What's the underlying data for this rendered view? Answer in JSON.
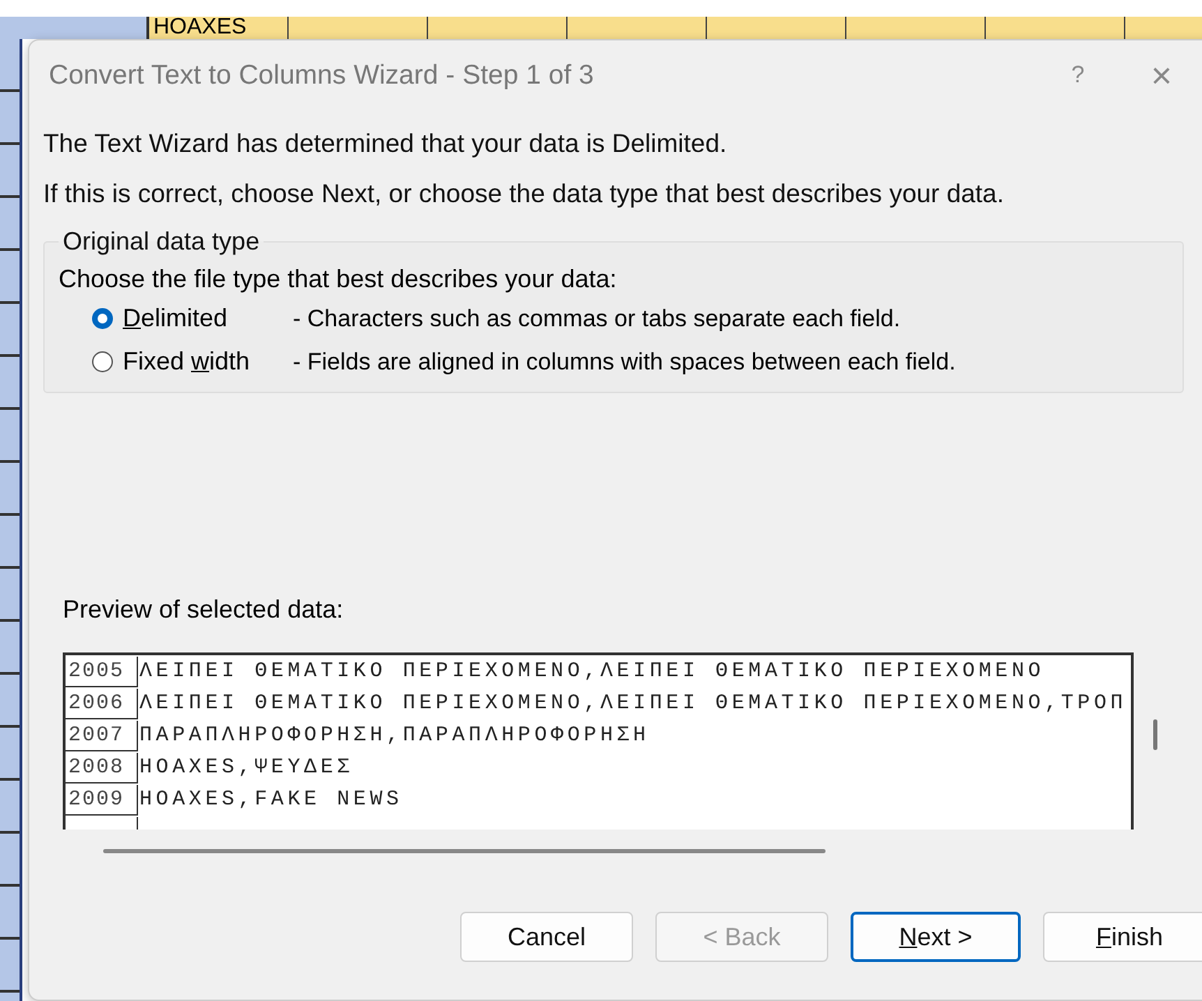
{
  "sheet": {
    "cells": [
      "HOAXES"
    ]
  },
  "window": {
    "title": "Convert Text to Columns Wizard - Step 1 of 3",
    "help": "?",
    "close": "×"
  },
  "intro": [
    "The Text Wizard has determined that your data is Delimited.",
    "If this is correct, choose Next, or choose the data type that best describes your data."
  ],
  "group": {
    "legend": "Original data type",
    "prompt": "Choose the file type that best describes your data:",
    "options": [
      {
        "key": "D",
        "post": "elimited",
        "description": "- Characters such as commas or tabs separate each field.",
        "selected": true
      },
      {
        "pre": "Fixed ",
        "key": "w",
        "post": "idth",
        "description": "- Fields are aligned in columns with spaces between each field.",
        "selected": false
      }
    ]
  },
  "preview": {
    "label": "Preview of selected data:",
    "rows": [
      {
        "number": "2005",
        "text": "ΛΕΙΠΕΙ ΘΕΜΑΤΙΚΟ ΠΕΡΙΕΧΟΜΕΝΟ,ΛΕΙΠΕΙ ΘΕΜΑΤΙΚΟ ΠΕΡΙΕΧΟΜΕΝΟ"
      },
      {
        "number": "2006",
        "text": "ΛΕΙΠΕΙ ΘΕΜΑΤΙΚΟ ΠΕΡΙΕΧΟΜΕΝΟ,ΛΕΙΠΕΙ ΘΕΜΑΤΙΚΟ ΠΕΡΙΕΧΟΜΕΝΟ,ΤΡΟΠ"
      },
      {
        "number": "2007",
        "text": "ΠΑΡΑΠΛΗΡΟΦΟΡΗΣΗ,ΠΑΡΑΠΛΗΡΟΦΟΡΗΣΗ"
      },
      {
        "number": "2008",
        "text": "HOAXES,ΨΕΥΔΕΣ"
      },
      {
        "number": "2009",
        "text": "HOAXES,FAKE NEWS"
      }
    ]
  },
  "buttons": [
    {
      "pre": "Cancel",
      "disabled": false,
      "default": false
    },
    {
      "pre": "< Back",
      "disabled": true,
      "default": false
    },
    {
      "key": "N",
      "post": "ext >",
      "disabled": false,
      "default": true
    },
    {
      "key": "F",
      "post": "inish",
      "disabled": false,
      "default": false
    }
  ]
}
